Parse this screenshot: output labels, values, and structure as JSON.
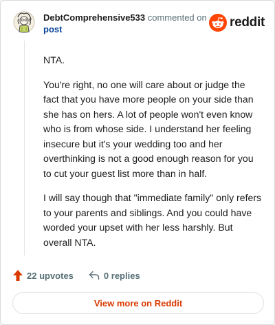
{
  "comment": {
    "username": "DebtComprehensive533",
    "meta_text": " commented on",
    "post_link": "post",
    "paragraphs": [
      "NTA.",
      "You're right, no one will care about or judge the fact that you have more people on your side than she has on hers. A lot of people won't even know who is from whose side. I understand her feeling insecure but it's your wedding too and her overthinking is not a good enough reason for you to cut your guest list more than in half.",
      "I will say though that \"immediate family\" only refers to your parents and siblings. And you could have worded your upset with her less harshly. But overall NTA."
    ]
  },
  "brand": {
    "name": "reddit",
    "color": "#ff4500"
  },
  "actions": {
    "upvotes": "22 upvotes",
    "replies": "0 replies",
    "upvote_color": "#d93a00"
  },
  "footer": {
    "view_more": "View more on Reddit"
  },
  "icons": {
    "upvote": "arrow-up-icon",
    "reply": "reply-arrow-icon",
    "brand": "reddit-snoo-icon",
    "avatar": "user-avatar"
  }
}
